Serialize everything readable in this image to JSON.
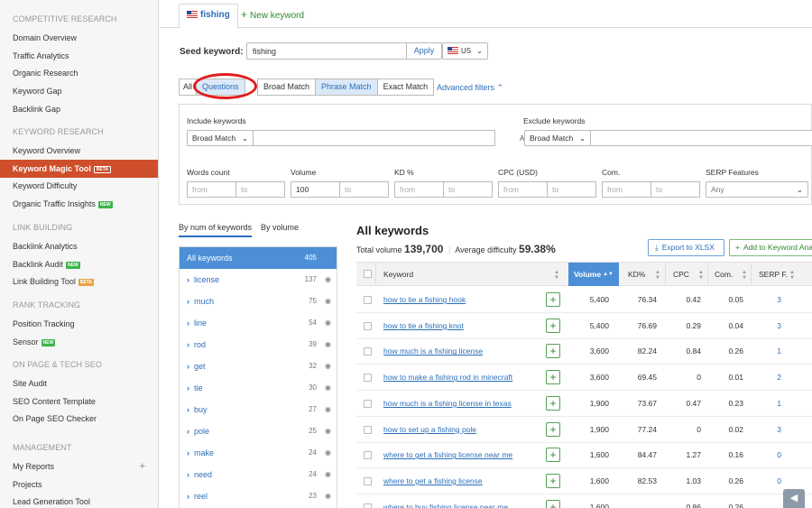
{
  "sidebar": {
    "sections": [
      {
        "title": "COMPETITIVE RESEARCH",
        "items": [
          {
            "label": "Domain Overview"
          },
          {
            "label": "Traffic Analytics"
          },
          {
            "label": "Organic Research"
          },
          {
            "label": "Keyword Gap"
          },
          {
            "label": "Backlink Gap"
          }
        ]
      },
      {
        "title": "KEYWORD RESEARCH",
        "items": [
          {
            "label": "Keyword Overview"
          },
          {
            "label": "Keyword Magic Tool",
            "badge": "beta",
            "active": true
          },
          {
            "label": "Keyword Difficulty"
          },
          {
            "label": "Organic Traffic Insights",
            "badge": "new"
          }
        ]
      },
      {
        "title": "LINK BUILDING",
        "items": [
          {
            "label": "Backlink Analytics"
          },
          {
            "label": "Backlink Audit",
            "badge": "new"
          },
          {
            "label": "Link Building Tool",
            "badge": "beta"
          }
        ]
      },
      {
        "title": "RANK TRACKING",
        "items": [
          {
            "label": "Position Tracking"
          },
          {
            "label": "Sensor",
            "badge": "new"
          }
        ]
      },
      {
        "title": "ON PAGE & TECH SEO",
        "items": [
          {
            "label": "Site Audit"
          },
          {
            "label": "SEO Content Template"
          },
          {
            "label": "On Page SEO Checker"
          }
        ]
      },
      {
        "title": "MANAGEMENT",
        "items": [
          {
            "label": "My Reports",
            "plus": true
          },
          {
            "label": "Projects"
          },
          {
            "label": "Lead Generation Tool"
          }
        ]
      }
    ]
  },
  "tabs": {
    "active": "fishing",
    "new_label": "New keyword"
  },
  "seed": {
    "label": "Seed keyword:",
    "value": "fishing",
    "apply": "Apply",
    "db": "US"
  },
  "match": {
    "all": "All",
    "questions": "Questions",
    "broad": "Broad Match",
    "phrase": "Phrase Match",
    "exact": "Exact Match",
    "advanced": "Advanced filters"
  },
  "filters": {
    "include_label": "Include keywords",
    "exclude_label": "Exclude keywords",
    "include_match": "Broad Match",
    "exclude_match": "Broad Match",
    "and": "AND",
    "words_count": "Words count",
    "volume": "Volume",
    "kd": "KD %",
    "cpc": "CPC (USD)",
    "com": "Com.",
    "serp": "SERP Features",
    "from": "from",
    "to": "to",
    "volume_from": "100",
    "serp_value": "Any"
  },
  "groups": {
    "tab_num": "By num of keywords",
    "tab_volume": "By volume",
    "all_label": "All keywords",
    "all_count": "405",
    "items": [
      {
        "label": "license",
        "count": "137"
      },
      {
        "label": "much",
        "count": "75"
      },
      {
        "label": "line",
        "count": "54"
      },
      {
        "label": "rod",
        "count": "39"
      },
      {
        "label": "get",
        "count": "32"
      },
      {
        "label": "tie",
        "count": "30"
      },
      {
        "label": "buy",
        "count": "27"
      },
      {
        "label": "pole",
        "count": "25"
      },
      {
        "label": "make",
        "count": "24"
      },
      {
        "label": "need",
        "count": "24"
      },
      {
        "label": "reel",
        "count": "23"
      }
    ]
  },
  "table": {
    "title": "All keywords",
    "total_volume_label": "Total volume",
    "total_volume": "139,700",
    "avg_diff_label": "Average difficulty",
    "avg_diff": "59.38%",
    "export": "Export to XLSX",
    "add_to": "Add to Keyword Analyzer",
    "headers": {
      "keyword": "Keyword",
      "volume": "Volume",
      "kd": "KD%",
      "cpc": "CPC",
      "com": "Com.",
      "serp": "SERP F."
    },
    "rows": [
      {
        "keyword": "how to tie a fishing hook",
        "volume": "5,400",
        "kd": "76.34",
        "cpc": "0.42",
        "com": "0.05",
        "serp": "3"
      },
      {
        "keyword": "how to tie a fishing knot",
        "volume": "5,400",
        "kd": "76.69",
        "cpc": "0.29",
        "com": "0.04",
        "serp": "3"
      },
      {
        "keyword": "how much is a fishing license",
        "volume": "3,600",
        "kd": "82.24",
        "cpc": "0.84",
        "com": "0.26",
        "serp": "1"
      },
      {
        "keyword": "how to make a fishing rod in minecraft",
        "volume": "3,600",
        "kd": "69.45",
        "cpc": "0",
        "com": "0.01",
        "serp": "2"
      },
      {
        "keyword": "how much is a fishing license in texas",
        "volume": "1,900",
        "kd": "73.67",
        "cpc": "0.47",
        "com": "0.23",
        "serp": "1"
      },
      {
        "keyword": "how to set up a fishing pole",
        "volume": "1,900",
        "kd": "77.24",
        "cpc": "0",
        "com": "0.02",
        "serp": "3"
      },
      {
        "keyword": "where to get a fishing license near me",
        "volume": "1,600",
        "kd": "84.47",
        "cpc": "1.27",
        "com": "0.16",
        "serp": "0"
      },
      {
        "keyword": "where to get a fishing license",
        "volume": "1,600",
        "kd": "82.53",
        "cpc": "1.03",
        "com": "0.26",
        "serp": "0"
      },
      {
        "keyword": "where to buy fishing license near me",
        "volume": "1,600",
        "kd": "",
        "cpc": "0.86",
        "com": "0.26",
        "serp": ""
      }
    ]
  },
  "colors": {
    "accent": "#2a6ebb",
    "active_nav": "#cf4f2c",
    "highlight": "#e21c1c",
    "volume_header": "#4c8fd6"
  }
}
